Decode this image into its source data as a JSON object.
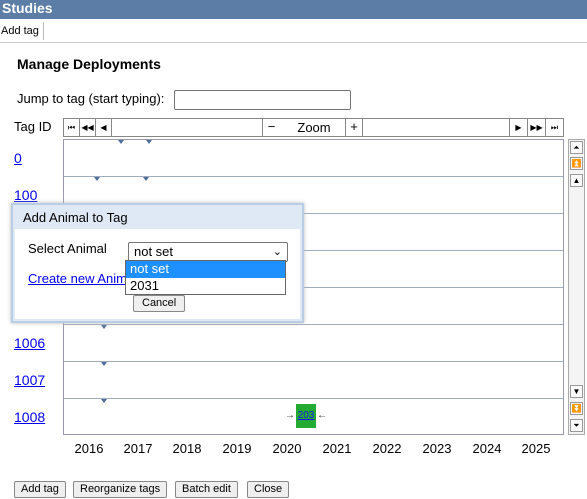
{
  "window": {
    "title": "Studies"
  },
  "toolbar": {
    "add_tag": "Add tag"
  },
  "page": {
    "heading": "Manage Deployments",
    "jump_label": "Jump to tag (start typing):",
    "jump_value": "",
    "tag_id_header": "Tag ID"
  },
  "nav": {
    "zoom": "Zoom",
    "minus": "−",
    "plus": "+"
  },
  "rows": [
    "0",
    "100",
    "",
    "",
    "",
    "1006",
    "1007",
    "1008"
  ],
  "years": [
    "2016",
    "2017",
    "2018",
    "2019",
    "2020",
    "2021",
    "2022",
    "2023",
    "2024",
    "2025"
  ],
  "deployment": {
    "label": "203",
    "year": 2020
  },
  "dialog": {
    "title": "Add Animal to Tag",
    "select_label": "Select Animal",
    "selected": "not set",
    "options": [
      "not set",
      "2031"
    ],
    "create_link": "Create new Animal",
    "cancel": "Cancel"
  },
  "bottom": {
    "add_tag": "Add tag",
    "reorganize": "Reorganize tags",
    "batch_edit": "Batch edit",
    "close": "Close"
  }
}
